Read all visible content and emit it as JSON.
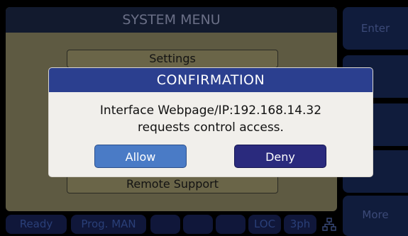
{
  "main": {
    "title": "SYSTEM MENU",
    "items": [
      "Settings",
      "Remote Support"
    ]
  },
  "status_bar": {
    "cells": [
      "Ready",
      "Prog. MAN",
      "",
      "",
      "",
      "",
      "LOC",
      "3ph"
    ],
    "network_icon": "network-icon"
  },
  "softkeys": [
    "Enter",
    "",
    "",
    "",
    "More"
  ],
  "dialog": {
    "title": "CONFIRMATION",
    "message_line1": "Interface Webpage/IP:192.168.14.32",
    "message_line2": "requests control access.",
    "allow_label": "Allow",
    "deny_label": "Deny"
  },
  "colors": {
    "dialog_title_bg": "#2b3f8f",
    "allow_button": "#4a7bc6",
    "deny_button": "#2a2a7d",
    "panel_dimmed": "#5e5a42"
  }
}
